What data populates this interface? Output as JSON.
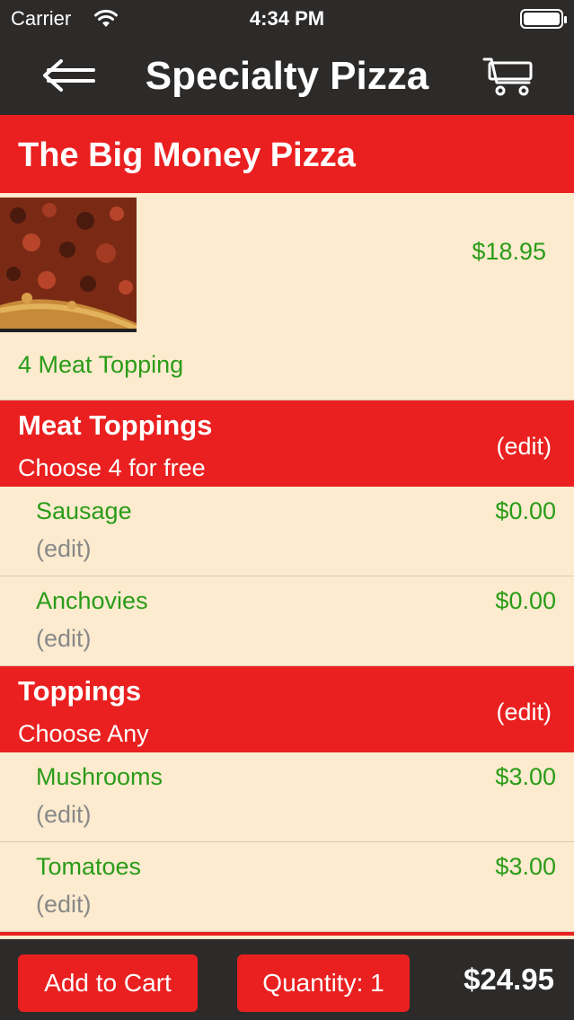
{
  "status": {
    "carrier": "Carrier",
    "time": "4:34 PM"
  },
  "nav": {
    "title": "Specialty Pizza"
  },
  "pizza": {
    "name": "The Big Money Pizza",
    "price": "$18.95",
    "description": "4 Meat Topping"
  },
  "sections": [
    {
      "name": "Meat Toppings",
      "subtitle": "Choose 4 for free",
      "edit": "(edit)",
      "items": [
        {
          "name": "Sausage",
          "price": "$0.00",
          "edit": "(edit)"
        },
        {
          "name": "Anchovies",
          "price": "$0.00",
          "edit": "(edit)"
        }
      ]
    },
    {
      "name": "Toppings",
      "subtitle": "Choose Any",
      "edit": "(edit)",
      "items": [
        {
          "name": "Mushrooms",
          "price": "$3.00",
          "edit": "(edit)"
        },
        {
          "name": "Tomatoes",
          "price": "$3.00",
          "edit": "(edit)"
        }
      ]
    }
  ],
  "footer": {
    "add_label": "Add to Cart",
    "quantity_label": "Quantity: 1",
    "total": "$24.95"
  },
  "colors": {
    "accent": "#ea2020",
    "price": "#2a9c18",
    "background": "#fdebcf",
    "bar": "#2d2b2a"
  },
  "icons": {
    "back": "arrow-left-icon",
    "cart": "cart-icon",
    "wifi": "wifi-icon",
    "battery": "battery-icon"
  }
}
